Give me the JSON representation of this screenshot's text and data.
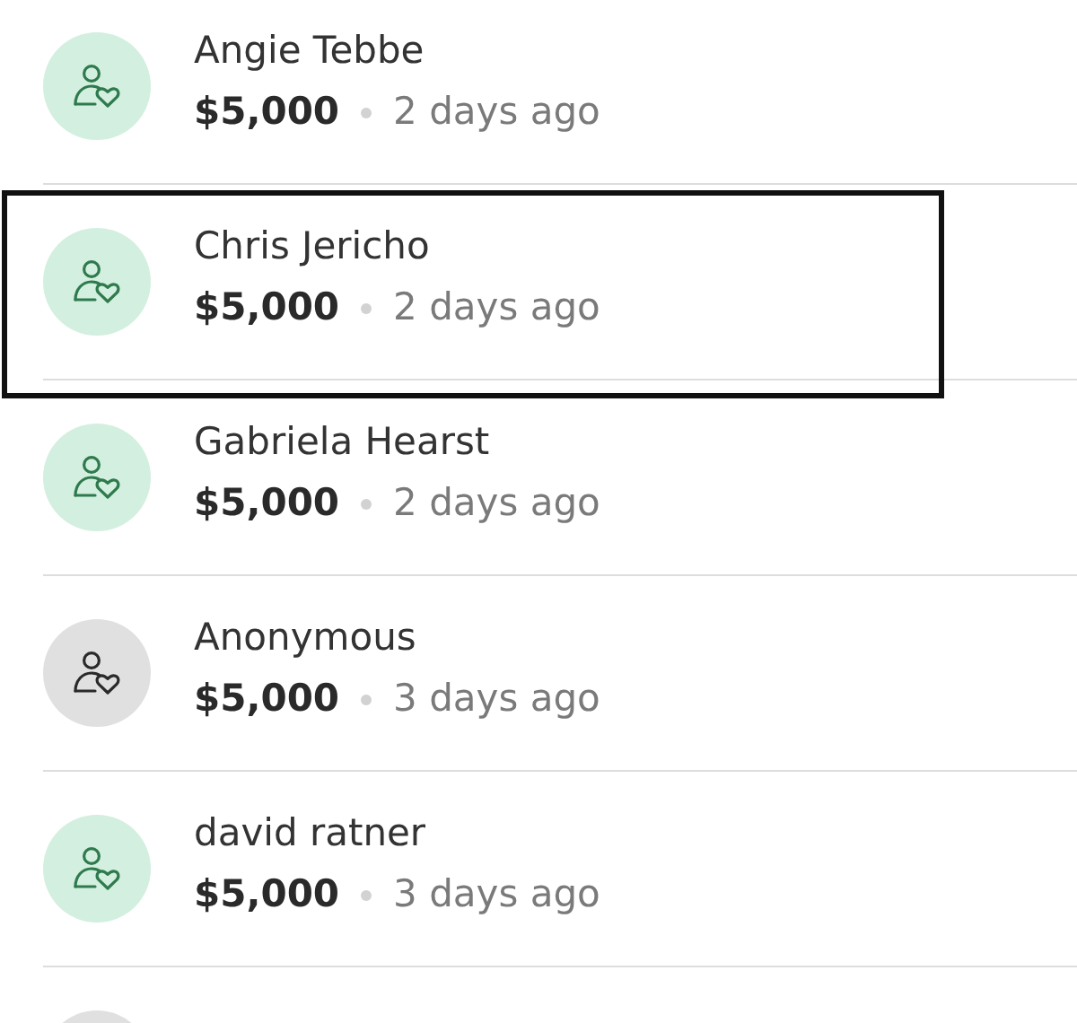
{
  "donations": [
    {
      "name": "Angie Tebbe",
      "amount": "$5,000",
      "time": "2 days ago",
      "anonymous": false,
      "highlighted": false
    },
    {
      "name": "Chris Jericho",
      "amount": "$5,000",
      "time": "2 days ago",
      "anonymous": false,
      "highlighted": true
    },
    {
      "name": "Gabriela Hearst",
      "amount": "$5,000",
      "time": "2 days ago",
      "anonymous": false,
      "highlighted": false
    },
    {
      "name": "Anonymous",
      "amount": "$5,000",
      "time": "3 days ago",
      "anonymous": true,
      "highlighted": false
    },
    {
      "name": "david ratner",
      "amount": "$5,000",
      "time": "3 days ago",
      "anonymous": false,
      "highlighted": false
    },
    {
      "anonymous": true,
      "highlighted": false
    }
  ]
}
